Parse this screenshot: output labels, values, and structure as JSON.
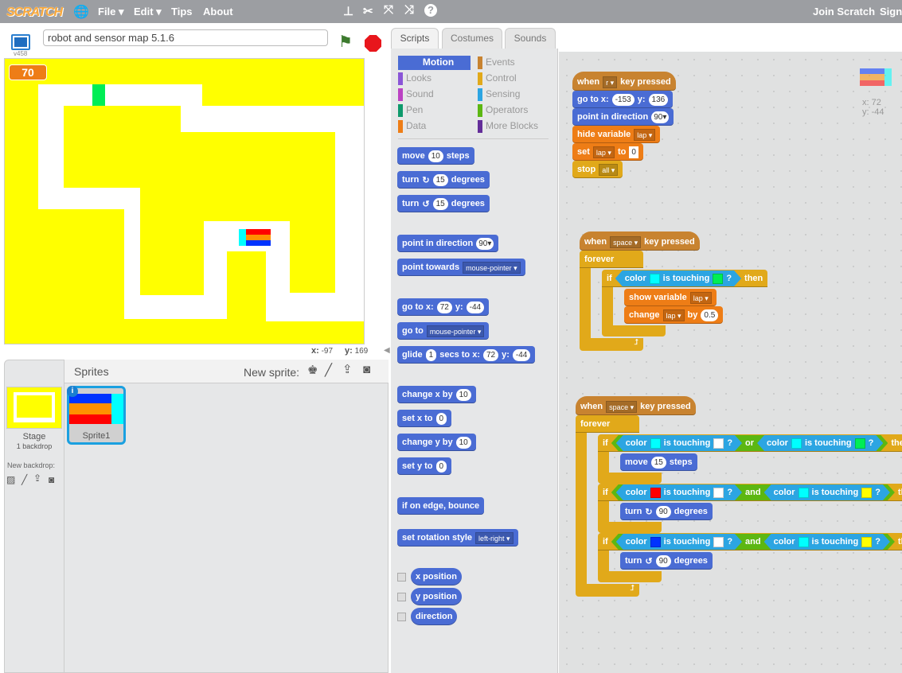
{
  "topbar": {
    "logo": "SCRATCH",
    "menu": [
      "File ▾",
      "Edit ▾",
      "Tips",
      "About"
    ],
    "right": [
      "Join Scratch",
      "Sign"
    ],
    "icons": [
      "globe-icon",
      "duplicate-icon",
      "cut-icon",
      "grow-icon",
      "shrink-icon",
      "help-icon"
    ]
  },
  "stage": {
    "version": "v458",
    "project_title": "robot and sensor map 5.1.6",
    "variable_value": "70",
    "mouse_x_label": "x:",
    "mouse_x": "-97",
    "mouse_y_label": "y:",
    "mouse_y": "169"
  },
  "sprites_pane": {
    "title": "Sprites",
    "new_sprite": "New sprite:",
    "stage_label": "Stage",
    "backdrops": "1 backdrop",
    "new_backdrop": "New backdrop:",
    "sprite_name": "Sprite1"
  },
  "tabs": [
    "Scripts",
    "Costumes",
    "Sounds"
  ],
  "categories": {
    "left": [
      "Motion",
      "Looks",
      "Sound",
      "Pen",
      "Data"
    ],
    "right": [
      "Events",
      "Control",
      "Sensing",
      "Operators",
      "More Blocks"
    ]
  },
  "colors": {
    "motion": "#4a6cd4",
    "looks": "#8a55d7",
    "sound": "#bb42c3",
    "pen": "#0e9a6c",
    "data": "#ee7d16",
    "events": "#c88330",
    "control": "#e1a91a",
    "sensing": "#2ca5e2",
    "operators": "#5cb712",
    "more": "#632d99"
  },
  "palette": [
    {
      "c": "motion",
      "p": [
        "move",
        {
          "num": "10"
        },
        "steps"
      ]
    },
    {
      "c": "motion",
      "p": [
        "turn",
        {
          "icon": "↻"
        },
        {
          "num": "15"
        },
        "degrees"
      ]
    },
    {
      "c": "motion",
      "p": [
        "turn",
        {
          "icon": "↺"
        },
        {
          "num": "15"
        },
        "degrees"
      ]
    },
    {
      "c": "motion",
      "p": [
        "point in direction",
        {
          "ddw": "90▾"
        }
      ]
    },
    {
      "c": "motion",
      "p": [
        "point towards",
        {
          "dd": "mouse-pointer ▾"
        }
      ]
    },
    {
      "c": "motion",
      "p": [
        "go to x:",
        {
          "num": "72"
        },
        "y:",
        {
          "num": "-44"
        }
      ]
    },
    {
      "c": "motion",
      "p": [
        "go to",
        {
          "dd": "mouse-pointer ▾"
        }
      ]
    },
    {
      "c": "motion",
      "p": [
        "glide",
        {
          "num": "1"
        },
        "secs to x:",
        {
          "num": "72"
        },
        "y:",
        {
          "num": "-44"
        }
      ]
    },
    {
      "c": "motion",
      "p": [
        "change x by",
        {
          "num": "10"
        }
      ]
    },
    {
      "c": "motion",
      "p": [
        "set x to",
        {
          "num": "0"
        }
      ]
    },
    {
      "c": "motion",
      "p": [
        "change y by",
        {
          "num": "10"
        }
      ]
    },
    {
      "c": "motion",
      "p": [
        "set y to",
        {
          "num": "0"
        }
      ]
    },
    {
      "c": "motion",
      "p": [
        "if on edge, bounce"
      ]
    },
    {
      "c": "motion",
      "p": [
        "set rotation style",
        {
          "dd": "left-right ▾"
        }
      ]
    },
    {
      "c": "motion",
      "rep": true,
      "p": [
        "x position"
      ]
    },
    {
      "c": "motion",
      "rep": true,
      "p": [
        "y position"
      ]
    },
    {
      "c": "motion",
      "rep": true,
      "p": [
        "direction"
      ]
    }
  ],
  "scripts": [
    [
      {
        "c": "events",
        "hat": true,
        "p": [
          "when",
          {
            "dd": "r ▾"
          },
          "key pressed"
        ]
      },
      {
        "c": "motion",
        "p": [
          "go to x:",
          {
            "num": "-153"
          },
          "y:",
          {
            "num": "136"
          }
        ]
      },
      {
        "c": "motion",
        "p": [
          "point in direction",
          {
            "ddw": "90▾"
          }
        ]
      },
      {
        "c": "data",
        "p": [
          "hide variable",
          {
            "dd": "lap ▾"
          }
        ]
      },
      {
        "c": "data",
        "p": [
          "set",
          {
            "dd": "lap ▾"
          },
          "to",
          {
            "inp": "0"
          }
        ]
      },
      {
        "c": "control",
        "p": [
          "stop",
          {
            "dd": "all ▾"
          }
        ]
      }
    ],
    [
      {
        "c": "events",
        "hat": true,
        "p": [
          "when",
          {
            "dd": "space ▾"
          },
          "key pressed"
        ]
      },
      {
        "c": "control",
        "p": [
          "forever"
        ],
        "body": [
          {
            "c": "control",
            "p": [
              "if",
              {
                "bool": {
                  "c": "sensing",
                  "p": [
                    "color",
                    {
                      "color": "#00ffff"
                    },
                    "is touching",
                    {
                      "color": "#00ee55"
                    },
                    "?"
                  ]
                }
              },
              "then"
            ],
            "body": [
              {
                "c": "data",
                "p": [
                  "show variable",
                  {
                    "dd": "lap ▾"
                  }
                ]
              },
              {
                "c": "data",
                "p": [
                  "change",
                  {
                    "dd": "lap ▾"
                  },
                  "by",
                  {
                    "num": "0.5"
                  }
                ]
              }
            ]
          }
        ],
        "loop": "⮥"
      }
    ],
    [
      {
        "c": "events",
        "hat": true,
        "p": [
          "when",
          {
            "dd": "space ▾"
          },
          "key pressed"
        ]
      },
      {
        "c": "control",
        "p": [
          "forever"
        ],
        "body": [
          {
            "c": "control",
            "p": [
              "if",
              {
                "bool": {
                  "c": "operators",
                  "p": [
                    {
                      "bool": {
                        "c": "sensing",
                        "p": [
                          "color",
                          {
                            "color": "#00ffff"
                          },
                          "is touching",
                          {
                            "color": "#ffffff"
                          },
                          "?"
                        ]
                      }
                    },
                    "or",
                    {
                      "bool": {
                        "c": "sensing",
                        "p": [
                          "color",
                          {
                            "color": "#00ffff"
                          },
                          "is touching",
                          {
                            "color": "#00ee55"
                          },
                          "?"
                        ]
                      }
                    }
                  ]
                }
              },
              "then"
            ],
            "body": [
              {
                "c": "motion",
                "p": [
                  "move",
                  {
                    "num": "15"
                  },
                  "steps"
                ]
              }
            ]
          },
          {
            "c": "control",
            "p": [
              "if",
              {
                "bool": {
                  "c": "operators",
                  "p": [
                    {
                      "bool": {
                        "c": "sensing",
                        "p": [
                          "color",
                          {
                            "color": "#ff0000"
                          },
                          "is touching",
                          {
                            "color": "#ffffff"
                          },
                          "?"
                        ]
                      }
                    },
                    "and",
                    {
                      "bool": {
                        "c": "sensing",
                        "p": [
                          "color",
                          {
                            "color": "#00ffff"
                          },
                          "is touching",
                          {
                            "color": "#ffff00"
                          },
                          "?"
                        ]
                      }
                    }
                  ]
                }
              },
              "then"
            ],
            "body": [
              {
                "c": "motion",
                "p": [
                  "turn",
                  {
                    "icon": "↻"
                  },
                  {
                    "num": "90"
                  },
                  "degrees"
                ]
              }
            ]
          },
          {
            "c": "control",
            "p": [
              "if",
              {
                "bool": {
                  "c": "operators",
                  "p": [
                    {
                      "bool": {
                        "c": "sensing",
                        "p": [
                          "color",
                          {
                            "color": "#0033ff"
                          },
                          "is touching",
                          {
                            "color": "#ffffff"
                          },
                          "?"
                        ]
                      }
                    },
                    "and",
                    {
                      "bool": {
                        "c": "sensing",
                        "p": [
                          "color",
                          {
                            "color": "#00ffff"
                          },
                          "is touching",
                          {
                            "color": "#ffff00"
                          },
                          "?"
                        ]
                      }
                    }
                  ]
                }
              },
              "then"
            ],
            "body": [
              {
                "c": "motion",
                "p": [
                  "turn",
                  {
                    "icon": "↺"
                  },
                  {
                    "num": "90"
                  },
                  "degrees"
                ]
              }
            ]
          }
        ],
        "loop": "⮥"
      }
    ]
  ],
  "sprite_info": {
    "x": "x: 72",
    "y": "y: -44"
  }
}
